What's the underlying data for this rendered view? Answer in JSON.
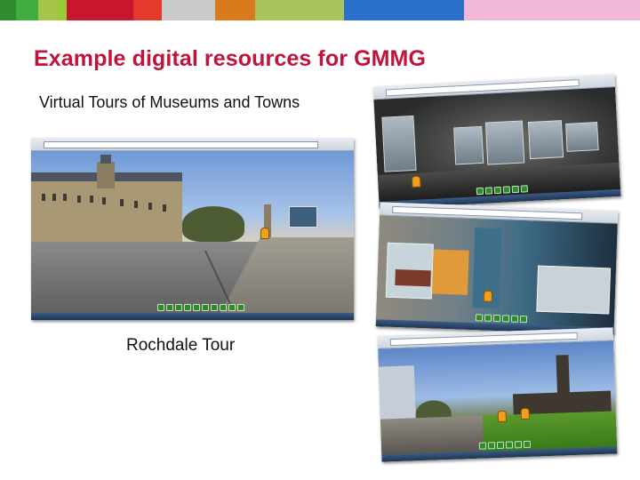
{
  "slide": {
    "title": "Example digital resources for GMMG",
    "subtitle": "Virtual Tours of Museums and Towns",
    "caption": "Rochdale Tour"
  },
  "color_bar": [
    "#2e8b2e",
    "#3fae3f",
    "#a8c34a",
    "#9ac93a",
    "#c9162e",
    "#e33a2b",
    "#c9cbc9",
    "#d97a1c",
    "#a8c45a",
    "#2a6fc9",
    "#f0b7d8"
  ],
  "screenshots": [
    {
      "name": "rochdale-street-view",
      "kind": "street"
    },
    {
      "name": "museum-interior-gallery",
      "kind": "museum"
    },
    {
      "name": "museum-interior-displays",
      "kind": "museum"
    },
    {
      "name": "town-hall-square",
      "kind": "town"
    }
  ]
}
